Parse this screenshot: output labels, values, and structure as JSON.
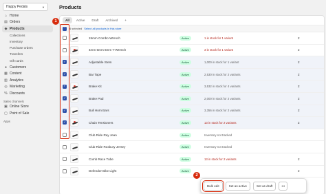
{
  "store": {
    "name": "Happy Pedals"
  },
  "page": {
    "title": "Products"
  },
  "sidebar": {
    "items": [
      {
        "label": "Home",
        "icon": "⌂",
        "icon_name": "home-icon",
        "active": false
      },
      {
        "label": "Orders",
        "icon": "▤",
        "icon_name": "orders-icon",
        "active": false
      },
      {
        "label": "Products",
        "icon": "◆",
        "icon_name": "tag-icon",
        "active": true
      }
    ],
    "product_sub": [
      "Collections",
      "Inventory",
      "Purchase orders",
      "Transfers",
      "Gift cards"
    ],
    "items2": [
      {
        "label": "Customers",
        "icon": "●",
        "icon_name": "person-icon"
      },
      {
        "label": "Content",
        "icon": "▦",
        "icon_name": "content-icon"
      },
      {
        "label": "Analytics",
        "icon": "▥",
        "icon_name": "analytics-icon"
      },
      {
        "label": "Marketing",
        "icon": "◎",
        "icon_name": "target-icon"
      },
      {
        "label": "Discounts",
        "icon": "%",
        "icon_name": "discount-icon"
      }
    ],
    "channels_label": "Sales channels",
    "channels": [
      {
        "label": "Online Store",
        "icon": "▣",
        "icon_name": "store-icon"
      },
      {
        "label": "Point of Sale",
        "icon": "▢",
        "icon_name": "pos-icon"
      }
    ],
    "apps_label": "Apps"
  },
  "tabs": [
    "All",
    "Active",
    "Draft",
    "Archived",
    "+"
  ],
  "selection": {
    "text": "6 selected",
    "link": "Select all products in this store"
  },
  "products": [
    {
      "name": "15mm Combo Wrench",
      "status": "Active",
      "inventory": "1 in stock for 1 variant",
      "warn": true,
      "count": "2",
      "selected": false,
      "red": false
    },
    {
      "name": "4mm 5mm 6mm Y-Wrench",
      "status": "Active",
      "inventory": "3 in stock for 1 variant",
      "warn": true,
      "count": "2",
      "selected": false,
      "red": true
    },
    {
      "name": "Adjustable Stem",
      "status": "Active",
      "inventory": "1,000 in stock for 1 variant",
      "warn": false,
      "count": "2",
      "selected": true,
      "red": false
    },
    {
      "name": "Bar Tape",
      "status": "Active",
      "inventory": "2,530 in stock for 2 variants",
      "warn": false,
      "count": "2",
      "selected": true,
      "red": false
    },
    {
      "name": "Brake Kit",
      "status": "Active",
      "inventory": "3,532 in stock for 4 variants",
      "warn": false,
      "count": "2",
      "selected": true,
      "red": true
    },
    {
      "name": "Brake Pad",
      "status": "Active",
      "inventory": "2,000 in stock for 2 variants",
      "warn": false,
      "count": "2",
      "selected": true,
      "red": false
    },
    {
      "name": "Bull Horn Bars",
      "status": "Active",
      "inventory": "3,356 in stock for 2 variants",
      "warn": false,
      "count": "2",
      "selected": true,
      "red": false
    },
    {
      "name": "Chain Tensioners",
      "status": "Active",
      "inventory": "13 in stock for 2 variants",
      "warn": true,
      "count": "2",
      "selected": true,
      "red": true
    },
    {
      "name": "Club Ride Ray Jean",
      "status": "Active",
      "inventory": "Inventory not tracked",
      "warn": false,
      "count": "",
      "selected": false,
      "red": false
    },
    {
      "name": "Club Ride Roxbury Jersey",
      "status": "Active",
      "inventory": "Inventory not tracked",
      "warn": false,
      "count": "",
      "selected": false,
      "red": false
    },
    {
      "name": "Comb Race Tube",
      "status": "Active",
      "inventory": "13 in stock for 2 variants",
      "warn": true,
      "count": "2",
      "selected": false,
      "red": false
    },
    {
      "name": "Defender Bike Light",
      "status": "Active",
      "inventory": "",
      "warn": false,
      "count": "2",
      "selected": false,
      "red": false
    }
  ],
  "bulk_actions": {
    "bulk_edit": "Bulk edit",
    "set_active": "Set as active",
    "set_draft": "Set as draft",
    "more": "•••"
  },
  "annotations": {
    "step1": "1",
    "step2": "2"
  },
  "colors": {
    "accent": "#2c4fa8",
    "annotation": "#d72c0d",
    "active_badge_bg": "#cdfee1",
    "warning_text": "#b42318"
  }
}
